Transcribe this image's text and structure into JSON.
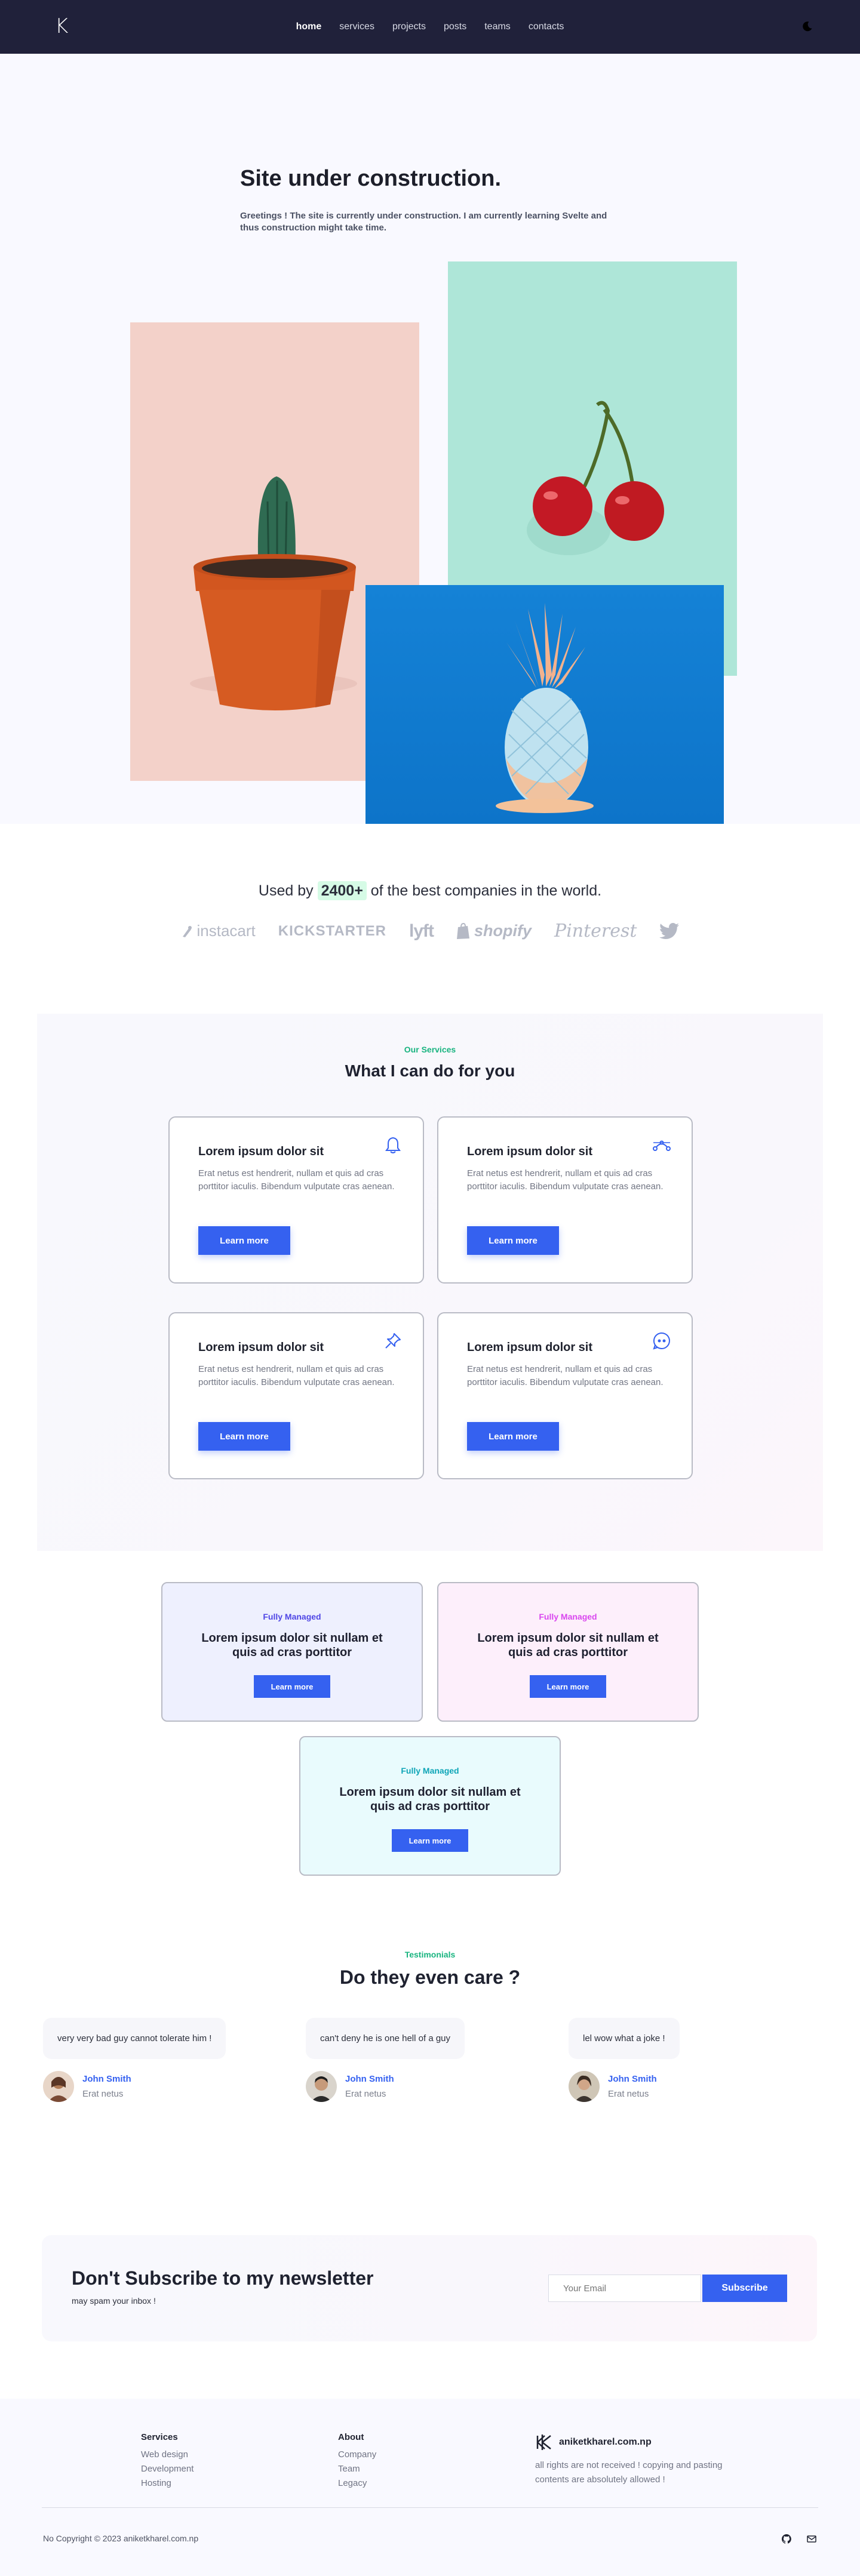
{
  "nav": {
    "logo": "K",
    "links": [
      "home",
      "services",
      "projects",
      "posts",
      "teams",
      "contacts"
    ],
    "active": "home",
    "theme_icon": "moon-icon"
  },
  "hero": {
    "title": "Site under construction.",
    "subtitle": "Greetings ! The site is currently under construction. I am currently learning Svelte and thus construction might take time."
  },
  "companies": {
    "prefix": "Used by",
    "count": "2400+",
    "suffix": "of the best companies in the world.",
    "logos": [
      "instacart",
      "KICKSTARTER",
      "lyft",
      "shopify",
      "Pinterest",
      "twitter-bird-icon"
    ]
  },
  "services": {
    "kicker": "Our Services",
    "title": "What I can do for you",
    "cards": [
      {
        "title": "Lorem ipsum dolor sit",
        "body": "Erat netus est hendrerit, nullam et quis ad cras porttitor iaculis. Bibendum vulputate cras aenean.",
        "button": "Learn more",
        "icon": "bell-icon"
      },
      {
        "title": "Lorem ipsum dolor sit",
        "body": "Erat netus est hendrerit, nullam et quis ad cras porttitor iaculis. Bibendum vulputate cras aenean.",
        "button": "Learn more",
        "icon": "bezier-curve-icon"
      },
      {
        "title": "Lorem ipsum dolor sit",
        "body": "Erat netus est hendrerit, nullam et quis ad cras porttitor iaculis. Bibendum vulputate cras aenean.",
        "button": "Learn more",
        "icon": "pin-icon"
      },
      {
        "title": "Lorem ipsum dolor sit",
        "body": "Erat netus est hendrerit, nullam et quis ad cras porttitor iaculis. Bibendum vulputate cras aenean.",
        "button": "Learn more",
        "icon": "quote-bubble-icon"
      }
    ]
  },
  "managed": {
    "cards": [
      {
        "kicker": "Fully Managed",
        "title": "Lorem ipsum dolor sit nullam et quis ad cras porttitor",
        "button": "Learn more",
        "accent": "#4f46e5",
        "bg": "#eef0fe"
      },
      {
        "kicker": "Fully Managed",
        "title": "Lorem ipsum dolor sit nullam et quis ad cras porttitor",
        "button": "Learn more",
        "accent": "#d946ef",
        "bg": "#fdeffb"
      },
      {
        "kicker": "Fully Managed",
        "title": "Lorem ipsum dolor sit nullam et quis ad cras porttitor",
        "button": "Learn more",
        "accent": "#0ea5b7",
        "bg": "#e9fbfd"
      }
    ]
  },
  "testimonials": {
    "kicker": "Testimonials",
    "title": "Do they even care ?",
    "items": [
      {
        "quote": "very very bad guy cannot tolerate him !",
        "name": "John Smith",
        "role": "Erat netus"
      },
      {
        "quote": "can't deny he is one hell of a guy",
        "name": "John Smith",
        "role": "Erat netus"
      },
      {
        "quote": "lel wow what a joke !",
        "name": "John Smith",
        "role": "Erat netus"
      }
    ]
  },
  "newsletter": {
    "title": "Don't Subscribe to my newsletter",
    "subtitle": "may spam your inbox !",
    "placeholder": "Your Email",
    "button": "Subscribe"
  },
  "footer": {
    "col1": {
      "title": "Services",
      "links": [
        "Web design",
        "Development",
        "Hosting"
      ]
    },
    "col2": {
      "title": "About",
      "links": [
        "Company",
        "Team",
        "Legacy"
      ]
    },
    "brand": "aniketkharel.com.np",
    "brand_text": "all rights are not received ! copying and pasting contents are absolutely allowed !",
    "copyright": "No Copyright © 2023 aniketkharel.com.np",
    "icons": [
      "github-icon",
      "mail-icon"
    ]
  },
  "colors": {
    "nav_bg": "#20213a",
    "primary": "#3561f0",
    "green": "#18b47f"
  }
}
